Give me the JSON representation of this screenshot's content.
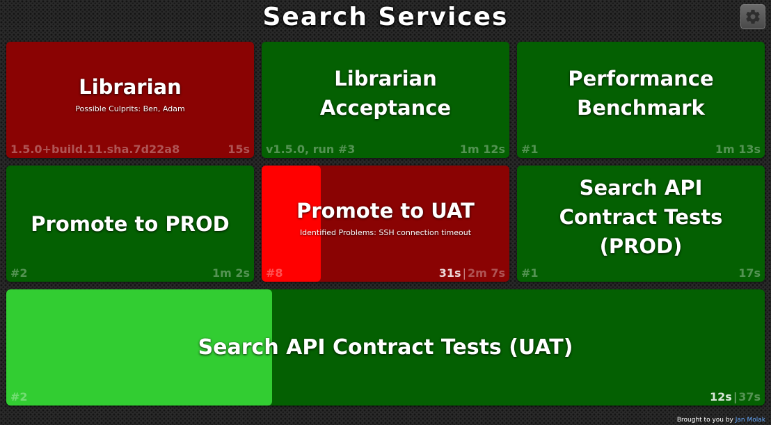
{
  "header": {
    "title": "Search Services",
    "settings_icon": "gear-icon"
  },
  "colors": {
    "success": "#046002",
    "failure": "#8a0303",
    "failure_progress": "#ff0000",
    "success_progress": "#32cd32"
  },
  "tiles": [
    {
      "name": "Librarian",
      "status": "failure",
      "detail": "Possible Culprits: Ben,  Adam",
      "build": "1.5.0+build.11.sha.7d22a8",
      "duration": "15s"
    },
    {
      "name": "Librarian Acceptance",
      "status": "success",
      "build": "v1.5.0, run #3",
      "duration": "1m 12s"
    },
    {
      "name": "Performance Benchmark",
      "status": "success",
      "build": "#1",
      "duration": "1m 13s"
    },
    {
      "name": "Promote to PROD",
      "status": "success",
      "build": "#2",
      "duration": "1m 2s"
    },
    {
      "name": "Promote to UAT",
      "status": "failure",
      "running": true,
      "progress_percent": 24,
      "detail": "Identified Problems: SSH connection timeout",
      "build": "#8",
      "elapsed": "31s",
      "duration": "2m 7s"
    },
    {
      "name": "Search API Contract Tests (PROD)",
      "status": "success",
      "build": "#1",
      "duration": "17s"
    },
    {
      "name": "Search API Contract Tests (UAT)",
      "status": "success",
      "running": true,
      "progress_percent": 35,
      "build": "#2",
      "elapsed": "12s",
      "duration": "37s"
    }
  ],
  "footer": {
    "credit_prefix": "Brought to you by",
    "credit_author": "Jan Molak"
  }
}
